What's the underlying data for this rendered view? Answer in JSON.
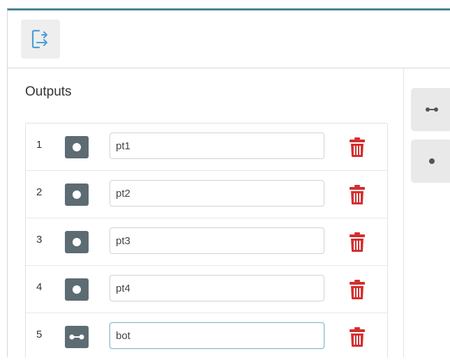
{
  "toolbar": {
    "export_icon": "export-outputs-icon"
  },
  "outputs_panel": {
    "title": "Outputs",
    "rows": [
      {
        "index": "1",
        "type_icon": "point-icon",
        "value": "pt1",
        "delete_icon": "trash-icon"
      },
      {
        "index": "2",
        "type_icon": "point-icon",
        "value": "pt2",
        "delete_icon": "trash-icon"
      },
      {
        "index": "3",
        "type_icon": "point-icon",
        "value": "pt3",
        "delete_icon": "trash-icon"
      },
      {
        "index": "4",
        "type_icon": "point-icon",
        "value": "pt4",
        "delete_icon": "trash-icon"
      },
      {
        "index": "5",
        "type_icon": "segment-icon",
        "value": "bot",
        "delete_icon": "trash-icon"
      }
    ]
  },
  "right_toolbar": {
    "buttons": [
      {
        "icon": "segment-icon"
      },
      {
        "icon": "point-icon"
      }
    ]
  },
  "colors": {
    "accent": "#4a8296",
    "badge": "#5c6c72",
    "delete": "#d32f2f",
    "export_icon": "#4b9fd5"
  }
}
